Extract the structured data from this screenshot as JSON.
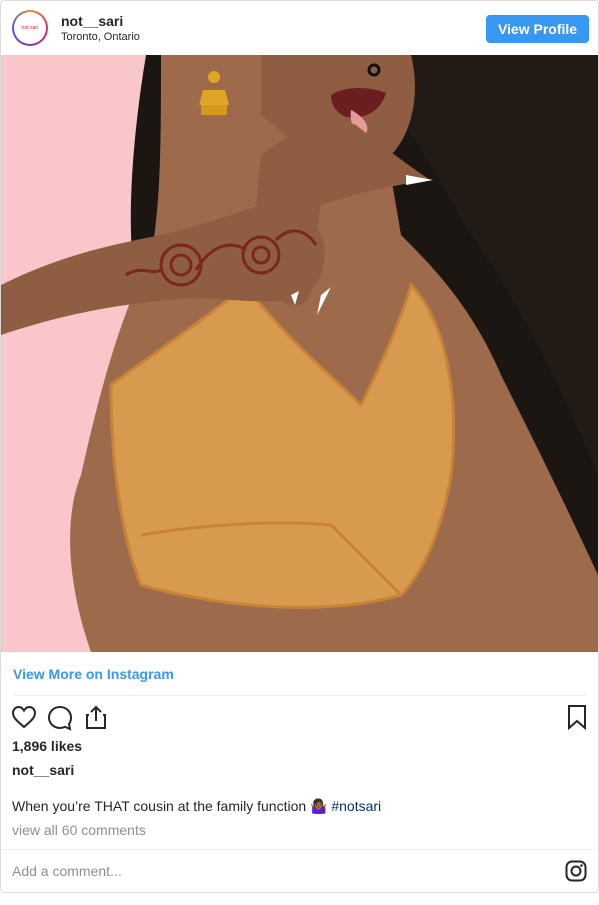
{
  "header": {
    "username": "not__sari",
    "location": "Toronto, Ontario",
    "avatar_text": "not sari",
    "view_profile_label": "View Profile"
  },
  "post": {
    "image_icon": "illustration",
    "view_more_label": "View More on Instagram",
    "likes": "1,896 likes",
    "caption_user": "not__sari",
    "caption_text": "When you’re THAT cousin at the family function 🤷🏾‍♀️ ",
    "caption_hashtag": "#notsari",
    "comments_link": "view all 60 comments",
    "add_comment_placeholder": "Add a comment..."
  },
  "icons": {
    "like": "heart-icon",
    "comment": "comment-icon",
    "share": "share-icon",
    "save": "bookmark-icon",
    "instagram": "instagram-icon"
  },
  "colors": {
    "accent": "#3897f0",
    "background": "#f9c7ca",
    "skin": "#9e6a4c",
    "top": "#d79a4e",
    "henna": "#7a2a14"
  }
}
